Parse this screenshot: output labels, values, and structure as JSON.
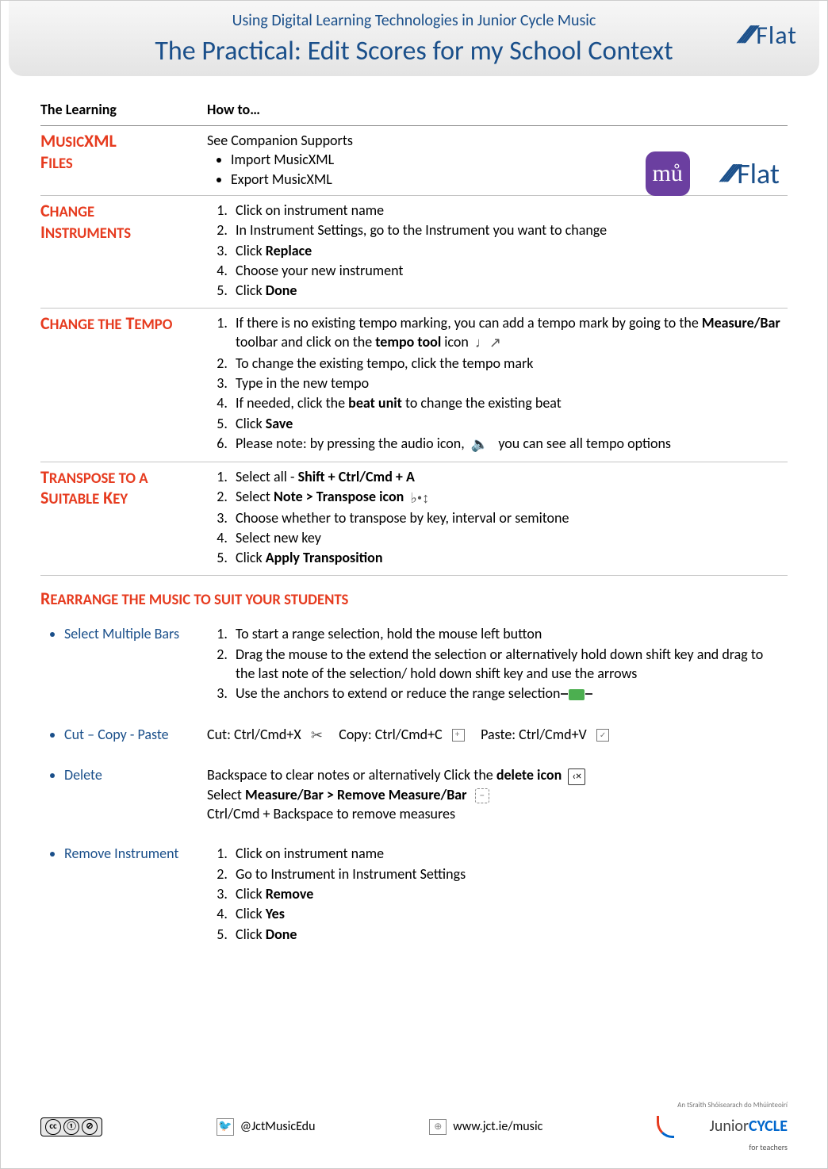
{
  "header": {
    "supertitle": "Using Digital Learning Technologies in Junior Cycle Music",
    "title": "The Practical: Edit Scores for my School Context",
    "brand": "Flat"
  },
  "table_headers": {
    "col1": "The Learning",
    "col2": "How to…"
  },
  "sections": {
    "musicxml": {
      "title": "MusicXML Files",
      "intro": "See Companion Supports",
      "bullets": [
        "Import MusicXML",
        "Export MusicXML"
      ],
      "brand_small": "Flat"
    },
    "change_instruments": {
      "title": "Change Instruments",
      "steps": [
        "Click on instrument name",
        "In Instrument Settings, go to the Instrument you want to change",
        "Click Replace",
        "Choose your new instrument",
        "Click Done"
      ],
      "steps_html": [
        "Click on instrument name",
        "In Instrument Settings, go to the Instrument you want to change",
        "Click <b>Replace</b>",
        "Choose your new instrument",
        "Click <b>Done</b>"
      ]
    },
    "change_tempo": {
      "title": "Change the Tempo",
      "steps_html": [
        "If there is no existing tempo marking, you can add a tempo mark by going to the <b>Measure/Bar</b> toolbar and click on the <b>tempo tool</b> icon <span class='inline-icon icon-tempo'>♩↗</span>",
        "To change the existing tempo, click the tempo mark",
        "Type in the new tempo",
        "If needed, click the <b>beat unit</b> to change the existing beat",
        "Click <b>Save</b>",
        "Please note: by pressing the audio icon, <span class='inline-icon icon-audio'>🔈</span>&nbsp;&nbsp;you can see all tempo options"
      ]
    },
    "transpose": {
      "title": "Transpose to a Suitable Key",
      "steps_html": [
        "Select all - <b>Shift + Ctrl/Cmd + A</b>",
        "Select <b>Note > Transpose icon</b> <span class='inline-icon icon-transpose'>♭•↕</span>",
        "Choose whether to transpose by key, interval or semitone",
        "Select new key",
        "Click <b>Apply Transposition</b>"
      ]
    },
    "rearrange": {
      "title": "Rearrange the music to suit your students",
      "rows": {
        "select_multiple": {
          "label": "Select Multiple Bars",
          "steps_html": [
            "To start a range selection, hold the mouse left button",
            "Drag the mouse to the extend the selection or alternatively hold down shift key and drag to the last note of the selection/ hold down shift key and use the arrows",
            "Use the anchors to extend or reduce the range selection <span class='icon-anchor'></span>"
          ]
        },
        "cut_copy_paste": {
          "label": "Cut – Copy - Paste",
          "line_html": "Cut: Ctrl/Cmd+X&nbsp;&nbsp;<span class='inline-icon icon-scissors'>✂</span>&nbsp;&nbsp;&nbsp;&nbsp;Copy: Ctrl/Cmd+C&nbsp;&nbsp;<span class='icon-copy-small'></span>&nbsp;&nbsp;&nbsp;&nbsp;Paste: Ctrl/Cmd+V&nbsp;&nbsp;<span class='icon-paste-small'></span>"
        },
        "delete": {
          "label": "Delete",
          "lines_html": [
            "Backspace to clear notes or alternatively Click the <b>delete icon</b> <span class='icon-delete'></span>",
            "Select <b>Measure/Bar > Remove Measure/Bar</b> <span class='icon-removebar'></span>",
            "Ctrl/Cmd + Backspace to remove measures"
          ]
        },
        "remove_instrument": {
          "label": "Remove Instrument",
          "steps_html": [
            "Click on instrument name",
            "Go to Instrument in Instrument Settings",
            "Click <b>Remove</b>",
            "Click <b>Yes</b>",
            "Click <b>Done</b>"
          ]
        }
      }
    }
  },
  "footer": {
    "twitter": "@JctMusicEdu",
    "url": "www.jct.ie/music",
    "jc_top": "An tSraith Shóisearach do Mhúinteoirí",
    "jc_main_a": "Junior",
    "jc_main_b": "CYCLE",
    "jc_sub": "for teachers",
    "cc_label": "cc",
    "cc_by": "BY",
    "cc_nc": "NC"
  }
}
